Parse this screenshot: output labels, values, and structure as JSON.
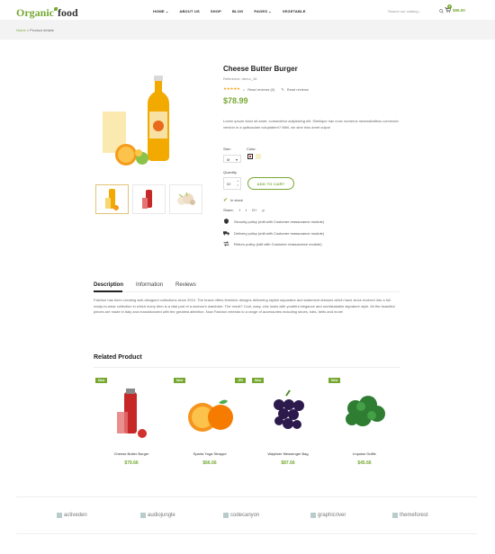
{
  "header": {
    "logo_part1": "Organic",
    "logo_part2": "food",
    "nav": [
      "HOME",
      "ABOUT US",
      "SHOP",
      "BLOG",
      "PAGES",
      "VEGETABLE"
    ],
    "search_placeholder": "Search our catalog...",
    "cart_count": "2",
    "cart_total": "$95.00"
  },
  "breadcrumb": {
    "home": "Home",
    "sep": " > ",
    "current": "Product details"
  },
  "product": {
    "title": "Cheese Butter Burger",
    "reference": "Reference: demo_16",
    "reviews_link": "Read reviews (0)",
    "write_review": "Read reviews",
    "price": "$78.99",
    "description": "Lorem ipsum dolor sit amet, consectetur adipisicing elit. Similique hac nunc numeros necessitatibus commodo version in a quibusdam voluptatem? Nihil, sin sine eius amet culpa!",
    "size_label": "Size:",
    "size_value": "M",
    "color_label": "Color:",
    "quantity_label": "Quantity",
    "quantity_value": "02",
    "add_to_cart": "ADD TO CART",
    "stock": "In stock",
    "share_label": "Share:",
    "share_icons": [
      "f",
      "t",
      "G+",
      "p"
    ],
    "policies": [
      "Security policy (edit with Customer reassurance module)",
      "Delivery policy (edit with Customer reassurance module)",
      "Return policy (edit with Customer reassurance module)"
    ]
  },
  "tabs": {
    "items": [
      "Description",
      "Information",
      "Reviews"
    ],
    "text": "Fashion has been creating well-designed collections since 2010. The brand offers feminine designs delivering stylish separates and statement dresses which have since evolved into a full ready-to-wear collection in which every item is a vital part of a woman's wardrobe. The result? Cool, easy, chic looks with youthful elegance and unmistakable signature style. All the beautiful pieces are made in Italy and manufactured with the greatest attention. Now Fashion extends to a range of accessories including shoes, hats, belts and more!"
  },
  "related": {
    "title": "Related Product",
    "items": [
      {
        "tag": "New",
        "name": "Cheese Butter Burger",
        "price": "$79.66"
      },
      {
        "tag": "New",
        "tag2": "-5%",
        "name": "Sparta Yoga Strappd",
        "price": "$66.66"
      },
      {
        "tag": "New",
        "name": "Wayfarer Messenger Bag",
        "price": "$87.66"
      },
      {
        "tag": "New",
        "name": "Impulse Duffle",
        "price": "$45.66"
      }
    ]
  },
  "brands": [
    "activeden",
    "audiojungle",
    "codecanyon",
    "graphicriver",
    "themeforest"
  ],
  "colors": {
    "accent": "#76a831",
    "star": "#f5a623"
  }
}
